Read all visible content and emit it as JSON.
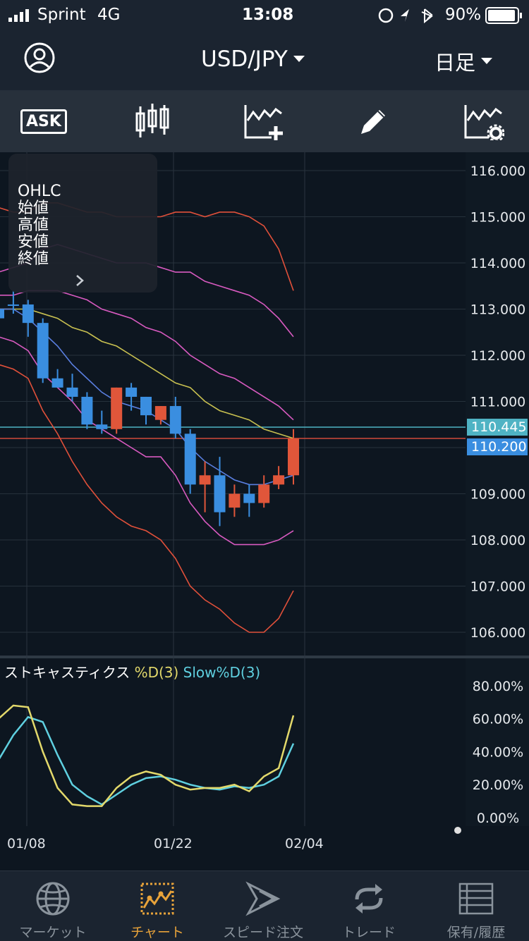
{
  "status_bar": {
    "carrier": "Sprint",
    "network": "4G",
    "time": "13:08",
    "battery": "90%"
  },
  "header": {
    "pair": "USD/JPY",
    "timeframe": "日足"
  },
  "toolbar": {
    "ask_label": "ASK"
  },
  "ohlc_panel": {
    "lines": [
      "OHLC",
      "始値",
      "高値",
      "安値",
      "終値"
    ]
  },
  "price_axis": {
    "ticks": [
      "116.000",
      "115.000",
      "114.000",
      "113.000",
      "112.000",
      "111.000",
      "110.000",
      "109.000",
      "108.000",
      "107.000",
      "106.000"
    ]
  },
  "price_labels": {
    "bid": "110.445",
    "ask": "110.200"
  },
  "stoch": {
    "title": "ストキャスティクス",
    "d_label": "%D(3)",
    "slow_label": "Slow%D(3)",
    "ticks": [
      "80.00%",
      "60.00%",
      "40.00%",
      "20.00%",
      "0.00%"
    ]
  },
  "dates": [
    "01/08",
    "01/22",
    "02/04"
  ],
  "colors": {
    "up": "#e0563a",
    "down": "#3a8ee0",
    "bid_line": "#4fb3c4",
    "ask_line": "#d04a3a",
    "d_line": "#e3d96b",
    "slow_line": "#5fd0e0",
    "bb_outer": "#e0503a",
    "bb_inner": "#d85ac0",
    "ma_short": "#5a7fe0",
    "ma_long": "#c8c050",
    "active_tab": "#e8a33a"
  },
  "tabs": [
    {
      "label": "マーケット",
      "icon": "globe-icon"
    },
    {
      "label": "チャート",
      "icon": "chart-icon",
      "active": true
    },
    {
      "label": "スピード注文",
      "icon": "speed-icon"
    },
    {
      "label": "トレード",
      "icon": "refresh-icon"
    },
    {
      "label": "保有/履歴",
      "icon": "list-icon"
    }
  ],
  "chart_data": {
    "type": "candlestick",
    "candles": [
      {
        "o": 113.0,
        "h": 113.2,
        "l": 112.8,
        "c": 112.8,
        "dir": "down"
      },
      {
        "o": 113.1,
        "h": 113.4,
        "l": 112.9,
        "c": 113.1,
        "dir": "down"
      },
      {
        "o": 113.1,
        "h": 113.2,
        "l": 112.4,
        "c": 112.7,
        "dir": "down"
      },
      {
        "o": 112.7,
        "h": 112.8,
        "l": 111.4,
        "c": 111.5,
        "dir": "down"
      },
      {
        "o": 111.5,
        "h": 111.7,
        "l": 111.3,
        "c": 111.3,
        "dir": "down"
      },
      {
        "o": 111.3,
        "h": 111.6,
        "l": 111.0,
        "c": 111.1,
        "dir": "down"
      },
      {
        "o": 111.1,
        "h": 111.2,
        "l": 110.4,
        "c": 110.5,
        "dir": "down"
      },
      {
        "o": 110.5,
        "h": 110.8,
        "l": 110.3,
        "c": 110.4,
        "dir": "down"
      },
      {
        "o": 110.4,
        "h": 111.3,
        "l": 110.3,
        "c": 111.3,
        "dir": "up"
      },
      {
        "o": 111.3,
        "h": 111.4,
        "l": 110.8,
        "c": 111.1,
        "dir": "down"
      },
      {
        "o": 111.1,
        "h": 111.1,
        "l": 110.5,
        "c": 110.7,
        "dir": "down"
      },
      {
        "o": 110.6,
        "h": 110.9,
        "l": 110.5,
        "c": 110.9,
        "dir": "up"
      },
      {
        "o": 110.9,
        "h": 111.1,
        "l": 110.2,
        "c": 110.3,
        "dir": "down"
      },
      {
        "o": 110.3,
        "h": 110.4,
        "l": 109.0,
        "c": 109.2,
        "dir": "down"
      },
      {
        "o": 109.2,
        "h": 109.7,
        "l": 108.6,
        "c": 109.4,
        "dir": "up"
      },
      {
        "o": 109.4,
        "h": 109.8,
        "l": 108.3,
        "c": 108.6,
        "dir": "down"
      },
      {
        "o": 108.7,
        "h": 109.2,
        "l": 108.5,
        "c": 109.0,
        "dir": "up"
      },
      {
        "o": 109.0,
        "h": 109.2,
        "l": 108.5,
        "c": 108.8,
        "dir": "down"
      },
      {
        "o": 108.8,
        "h": 109.4,
        "l": 108.7,
        "c": 109.2,
        "dir": "up"
      },
      {
        "o": 109.2,
        "h": 109.6,
        "l": 109.1,
        "c": 109.4,
        "dir": "up"
      },
      {
        "o": 109.4,
        "h": 110.4,
        "l": 109.2,
        "c": 110.2,
        "dir": "up"
      }
    ],
    "bb_upper2": [
      115.2,
      115.1,
      115.1,
      115.3,
      115.3,
      115.2,
      115.1,
      115.1,
      115.0,
      115.0,
      115.0,
      115.0,
      115.1,
      115.1,
      115.0,
      115.1,
      115.1,
      115.0,
      114.8,
      114.3,
      113.4
    ],
    "bb_upper1": [
      113.8,
      113.9,
      114.0,
      114.3,
      114.4,
      114.3,
      114.2,
      114.1,
      114.0,
      114.0,
      114.0,
      113.9,
      113.8,
      113.8,
      113.6,
      113.5,
      113.4,
      113.3,
      113.1,
      112.8,
      112.4
    ],
    "bb_mid_ma": [
      113.3,
      113.3,
      113.4,
      113.4,
      113.4,
      113.3,
      113.2,
      113.0,
      112.9,
      112.8,
      112.6,
      112.5,
      112.3,
      112.0,
      111.8,
      111.6,
      111.5,
      111.3,
      111.1,
      110.9,
      110.6
    ],
    "ma_long": [
      113.0,
      113.0,
      113.0,
      112.9,
      112.8,
      112.6,
      112.5,
      112.3,
      112.2,
      112.0,
      111.8,
      111.6,
      111.4,
      111.3,
      111.0,
      110.8,
      110.7,
      110.6,
      110.4,
      110.3,
      110.2
    ],
    "ma_short": [
      113.0,
      113.0,
      112.8,
      112.5,
      112.2,
      111.8,
      111.5,
      111.2,
      111.0,
      110.9,
      110.8,
      110.6,
      110.4,
      110.0,
      109.7,
      109.5,
      109.3,
      109.2,
      109.2,
      109.3,
      109.4
    ],
    "bb_lower1": [
      112.4,
      112.3,
      112.1,
      111.6,
      111.3,
      111.0,
      110.6,
      110.4,
      110.2,
      110.0,
      109.8,
      109.8,
      109.4,
      108.8,
      108.4,
      108.1,
      107.9,
      107.9,
      107.9,
      108.0,
      108.2
    ],
    "bb_lower2": [
      111.8,
      111.7,
      111.5,
      110.8,
      110.3,
      109.7,
      109.2,
      108.8,
      108.5,
      108.3,
      108.2,
      108.0,
      107.6,
      107.0,
      106.7,
      106.5,
      106.2,
      106.0,
      106.0,
      106.3,
      106.9
    ],
    "stoch_d": [
      60,
      68,
      67,
      40,
      18,
      8,
      7,
      7,
      18,
      25,
      28,
      26,
      20,
      17,
      18,
      18,
      20,
      16,
      25,
      30,
      62
    ],
    "stoch_slow": [
      35,
      50,
      61,
      58,
      38,
      20,
      13,
      8,
      14,
      20,
      24,
      25,
      23,
      20,
      18,
      17,
      19,
      18,
      20,
      25,
      45
    ],
    "ylim": [
      105.6,
      116.4
    ]
  }
}
